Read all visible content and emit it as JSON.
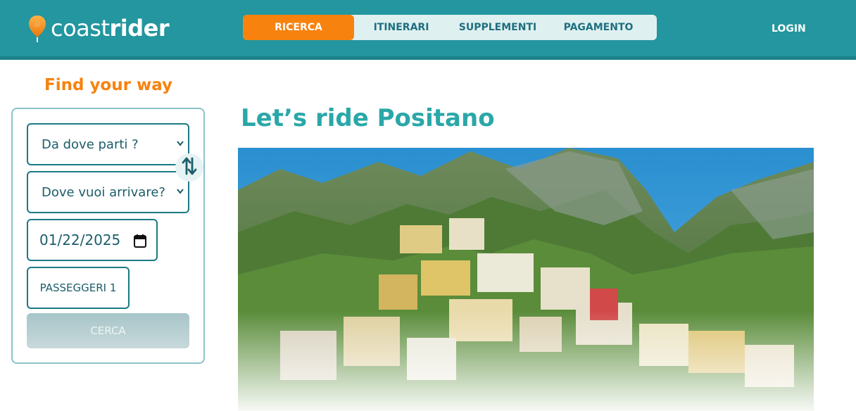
{
  "brand": {
    "light": "coast",
    "bold": "rider"
  },
  "nav": {
    "tabs": [
      {
        "label": "RICERCA",
        "active": true
      },
      {
        "label": "ITINERARI",
        "active": false
      },
      {
        "label": "SUPPLEMENTI",
        "active": false
      },
      {
        "label": "PAGAMENTO",
        "active": false
      }
    ],
    "login": "LOGIN"
  },
  "search": {
    "title": "Find your way",
    "from_placeholder": "Da dove parti ?",
    "to_placeholder": "Dove vuoi arrivare?",
    "date_value": "01/22/2025",
    "passengers_label": "PASSEGGERI 1",
    "submit_label": "CERCA"
  },
  "main": {
    "title": "Let’s ride Positano"
  },
  "colors": {
    "header": "#23969f",
    "accent": "#f7820e",
    "title": "#2aa7a8",
    "field_border": "#1a7a84"
  },
  "icons": [
    "location-pin-icon",
    "swap-vertical-icon",
    "calendar-icon",
    "chevron-down-icon"
  ]
}
